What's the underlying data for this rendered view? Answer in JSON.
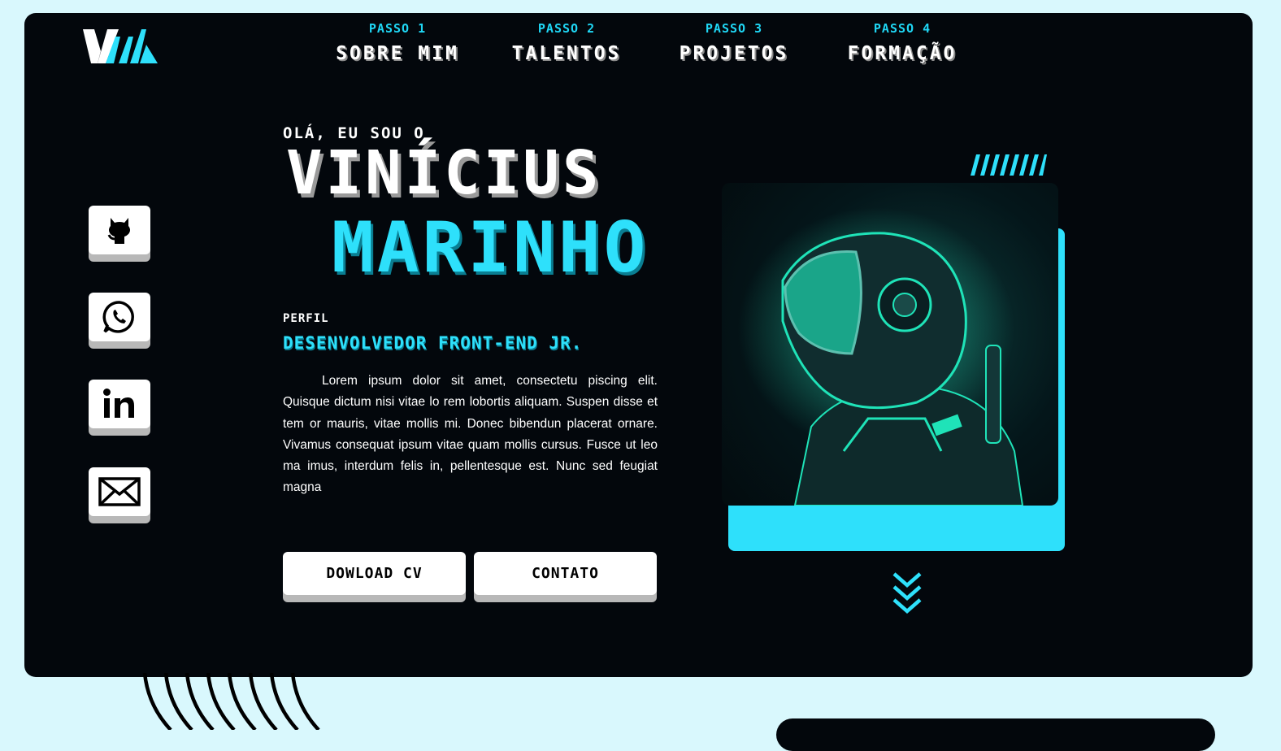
{
  "brand": {
    "logo_text": "VM"
  },
  "nav": [
    {
      "step": "PASSO 1",
      "label": "SOBRE MIM"
    },
    {
      "step": "PASSO 2",
      "label": "TALENTOS"
    },
    {
      "step": "PASSO 3",
      "label": "PROJETOS"
    },
    {
      "step": "PASSO 4",
      "label": "FORMAÇÃO"
    }
  ],
  "social": [
    {
      "icon": "github-icon"
    },
    {
      "icon": "whatsapp-icon"
    },
    {
      "icon": "linkedin-icon"
    },
    {
      "icon": "mail-icon"
    }
  ],
  "hero": {
    "greeting": "OLÁ, EU SOU O",
    "first_name": "VINÍCIUS",
    "last_name": "MARINHO",
    "profile_label": "PERFIL",
    "role": "DESENVOLVEDOR FRONT-END JR.",
    "bio": "Lorem ipsum dolor sit amet, consectetu piscing elit. Quisque dictum nisi vitae lo rem lobortis aliquam. Suspen disse et tem or mauris, vitae mollis mi. Donec bibendun placerat ornare. Vivamus consequat ipsum vitae quam mollis cursus. Fusce ut leo ma imus, interdum felis in, pellentesque est. Nunc sed feugiat magna"
  },
  "buttons": {
    "download": "DOWLOAD CV",
    "contact": "CONTATO"
  },
  "colors": {
    "page_bg": "#d9f8fd",
    "panel_bg": "#03070c",
    "accent": "#2ee0fb",
    "astronaut_glow": "#1fe3b8"
  }
}
